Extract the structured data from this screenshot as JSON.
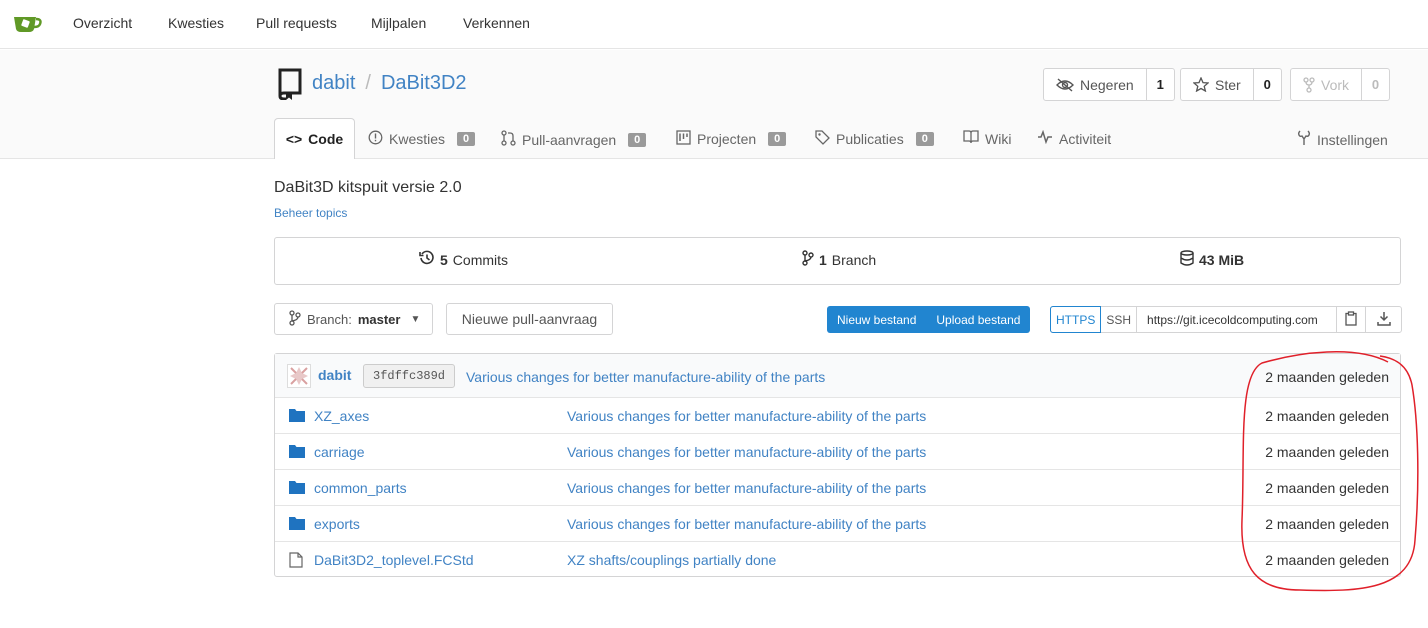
{
  "navbar": {
    "items": [
      "Overzicht",
      "Kwesties",
      "Pull requests",
      "Mijlpalen",
      "Verkennen"
    ]
  },
  "repo": {
    "owner": "dabit",
    "separator": "/",
    "name": "DaBit3D2",
    "watch": {
      "label": "Negeren",
      "count": "1"
    },
    "star": {
      "label": "Ster",
      "count": "0"
    },
    "fork": {
      "label": "Vork",
      "count": "0"
    }
  },
  "tabs": {
    "code": "Code",
    "issues": {
      "label": "Kwesties",
      "count": "0"
    },
    "pulls": {
      "label": "Pull-aanvragen",
      "count": "0"
    },
    "projects": {
      "label": "Projecten",
      "count": "0"
    },
    "releases": {
      "label": "Publicaties",
      "count": "0"
    },
    "wiki": "Wiki",
    "activity": "Activiteit",
    "settings": "Instellingen"
  },
  "description": "DaBit3D kitspuit versie 2.0",
  "topics_link": "Beheer topics",
  "stats": {
    "commits_count": "5",
    "commits_label": "Commits",
    "branch_count": "1",
    "branch_label": "Branch",
    "size": "43 MiB"
  },
  "actions": {
    "branch_label": "Branch:",
    "branch_name": "master",
    "new_pr": "Nieuwe pull-aanvraag",
    "new_file": "Nieuw bestand",
    "upload_file": "Upload bestand",
    "https": "HTTPS",
    "ssh": "SSH",
    "clone_url": "https://git.icecoldcomputing.com"
  },
  "latest_commit": {
    "author": "dabit",
    "sha": "3fdffc389d",
    "message": "Various changes for better manufacture-ability of the parts",
    "time": "2 maanden geleden"
  },
  "files": [
    {
      "type": "folder",
      "name": "XZ_axes",
      "message": "Various changes for better manufacture-ability of the parts",
      "time": "2 maanden geleden"
    },
    {
      "type": "folder",
      "name": "carriage",
      "message": "Various changes for better manufacture-ability of the parts",
      "time": "2 maanden geleden"
    },
    {
      "type": "folder",
      "name": "common_parts",
      "message": "Various changes for better manufacture-ability of the parts",
      "time": "2 maanden geleden"
    },
    {
      "type": "folder",
      "name": "exports",
      "message": "Various changes for better manufacture-ability of the parts",
      "time": "2 maanden geleden"
    },
    {
      "type": "file",
      "name": "DaBit3D2_toplevel.FCStd",
      "message": "XZ shafts/couplings partially done",
      "time": "2 maanden geleden"
    }
  ],
  "colors": {
    "link": "#4183c4",
    "primary": "#2185d0",
    "annotation": "#e0202a",
    "logo": "#609926"
  }
}
